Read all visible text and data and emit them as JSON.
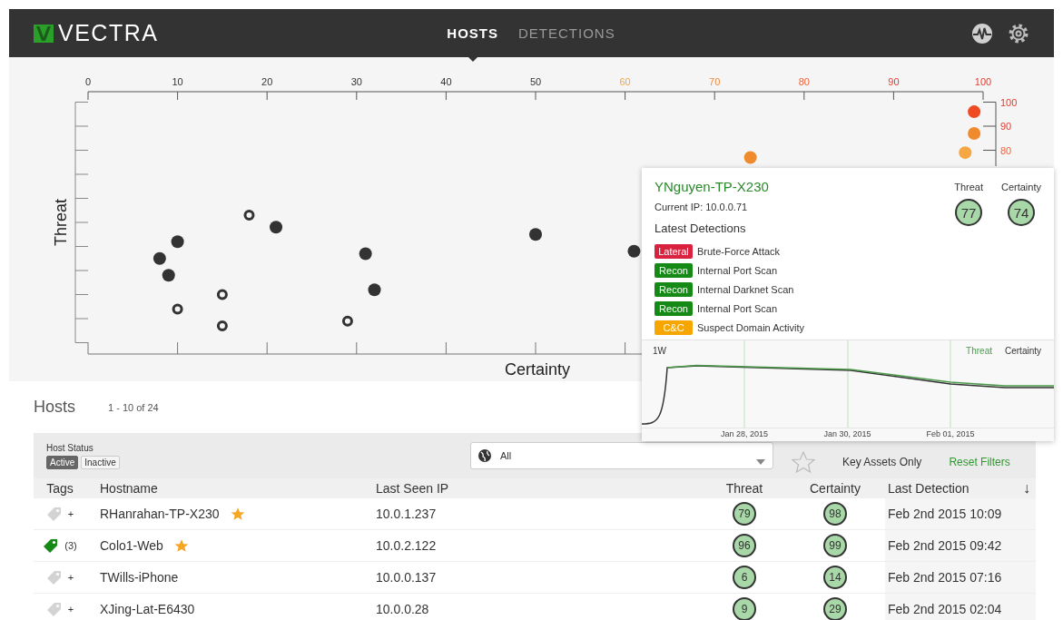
{
  "nav": {
    "logo": "VECTRA",
    "tabs": [
      {
        "label": "HOSTS",
        "selected": true
      },
      {
        "label": "DETECTIONS",
        "selected": false
      }
    ]
  },
  "scatter": {
    "chart_data": {
      "type": "scatter",
      "xlabel": "Certainty",
      "ylabel": "Threat",
      "xlim": [
        0,
        100
      ],
      "ylim": [
        0,
        100
      ],
      "xticks": [
        0,
        10,
        20,
        30,
        40,
        50,
        60,
        70,
        80,
        90,
        100
      ],
      "yticks": [
        {
          "value": 100,
          "label": "100"
        },
        {
          "value": 90,
          "label": "90"
        },
        {
          "value": 80,
          "label": "80"
        }
      ],
      "x": [
        99,
        99,
        98,
        74,
        18,
        21,
        10,
        8,
        9,
        15,
        10,
        15,
        29,
        31,
        32,
        50,
        61
      ],
      "series": [
        {
          "color": "#333333",
          "values": [
            null,
            null,
            null,
            null,
            null,
            48,
            42,
            35,
            28,
            null,
            null,
            null,
            null,
            37,
            22,
            45,
            38
          ]
        },
        {
          "color": "#333333",
          "values": [
            null,
            null,
            null,
            null,
            53,
            null,
            null,
            null,
            null,
            20,
            14,
            7,
            9,
            null,
            null,
            null,
            null
          ]
        },
        {
          "color": "#f04a23",
          "values": [
            96,
            null,
            null,
            null,
            null,
            null,
            null,
            null,
            null,
            null,
            null,
            null,
            null,
            null,
            null,
            null,
            null
          ]
        },
        {
          "color": "#ef8a2d",
          "values": [
            null,
            87,
            null,
            77,
            null,
            null,
            null,
            null,
            null,
            null,
            null,
            null,
            null,
            null,
            null,
            null,
            null
          ]
        },
        {
          "color": "#f4a742",
          "values": [
            null,
            null,
            79,
            null,
            null,
            null,
            null,
            null,
            null,
            null,
            null,
            null,
            null,
            null,
            null,
            null,
            null
          ]
        }
      ]
    },
    "series_styles": [
      {
        "kind": "filled"
      },
      {
        "kind": "hollow"
      },
      {
        "kind": "filled"
      },
      {
        "kind": "filled"
      },
      {
        "kind": "filled"
      }
    ]
  },
  "tooltip": {
    "hostname": "YNguyen-TP-X230",
    "current_ip": "Current IP: 10.0.0.71",
    "threat_label": "Threat",
    "certainty_label": "Certainty",
    "threat": "77",
    "certainty": "74",
    "detections_title": "Latest Detections",
    "detections": [
      {
        "category": "Lateral",
        "name": "Brute-Force Attack",
        "color": "#d9223f"
      },
      {
        "category": "Recon",
        "name": "Internal Port Scan",
        "color": "#168a16"
      },
      {
        "category": "Recon",
        "name": "Internal Darknet Scan",
        "color": "#168a16"
      },
      {
        "category": "Recon",
        "name": "Internal Port Scan",
        "color": "#168a16"
      },
      {
        "category": "C&C",
        "name": "Suspect Domain Activity",
        "color": "#f7a600"
      }
    ],
    "trend": {
      "range": "1W",
      "legend": [
        {
          "label": "Threat",
          "color": "#4c9a4c"
        },
        {
          "label": "Certainty",
          "color": "#333333"
        }
      ],
      "dates": [
        "Jan 28, 2015",
        "Jan 30, 2015",
        "Feb 01, 2015"
      ]
    }
  },
  "hosts": {
    "title": "Hosts",
    "count": "1 - 10 of 24",
    "filters": {
      "status_label": "Host Status",
      "status_options": [
        {
          "label": "Active",
          "selected": true
        },
        {
          "label": "Inactive",
          "selected": false
        }
      ],
      "group_select": {
        "value": "All"
      },
      "key_assets": {
        "label": "Key Assets Only",
        "checked": false
      },
      "reset": "Reset Filters"
    },
    "columns": [
      {
        "label": "Tags"
      },
      {
        "label": "Hostname"
      },
      {
        "label": "Last Seen IP"
      },
      {
        "label": "Threat"
      },
      {
        "label": "Certainty"
      },
      {
        "label": "Last Detection",
        "sort": "↓"
      }
    ],
    "rows": [
      {
        "tagged": false,
        "tag_label": "+",
        "hostname": "RHanrahan-TP-X230",
        "key_asset": true,
        "ip": "10.0.1.237",
        "threat": "79",
        "certainty": "98",
        "last_detection": "Feb 2nd 2015 10:09"
      },
      {
        "tagged": true,
        "tag_label": "(3)",
        "hostname": "Colo1-Web",
        "key_asset": true,
        "ip": "10.0.2.122",
        "threat": "96",
        "certainty": "99",
        "last_detection": "Feb 2nd 2015 09:42"
      },
      {
        "tagged": false,
        "tag_label": "+",
        "hostname": "TWills-iPhone",
        "key_asset": false,
        "ip": "10.0.0.137",
        "threat": "6",
        "certainty": "14",
        "last_detection": "Feb 2nd 2015 07:16"
      },
      {
        "tagged": false,
        "tag_label": "+",
        "hostname": "XJing-Lat-E6430",
        "key_asset": false,
        "ip": "10.0.0.28",
        "threat": "9",
        "certainty": "29",
        "last_detection": "Feb 2nd 2015 02:04"
      }
    ]
  }
}
